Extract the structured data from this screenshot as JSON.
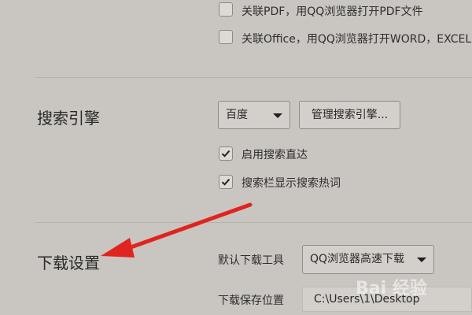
{
  "file_assoc": {
    "pdf_label": "关联PDF，用QQ浏览器打开PDF文件",
    "office_label": "关联Office，用QQ浏览器打开WORD，EXCEL"
  },
  "search": {
    "title": "搜索引擎",
    "engine_selected": "百度",
    "manage_button": "管理搜索引擎...",
    "direct_label": "启用搜索直达",
    "hotwords_label": "搜索栏显示搜索热词",
    "direct_checked": true,
    "hotwords_checked": true
  },
  "download": {
    "title": "下载设置",
    "default_tool_label": "默认下载工具",
    "default_tool_value": "QQ浏览器高速下载",
    "save_location_label": "下载保存位置",
    "save_location_value": "C:\\Users\\1\\Desktop"
  },
  "annotation": {
    "arrow_color": "#e0241f"
  },
  "watermark": {
    "text": "Bai 经验"
  }
}
